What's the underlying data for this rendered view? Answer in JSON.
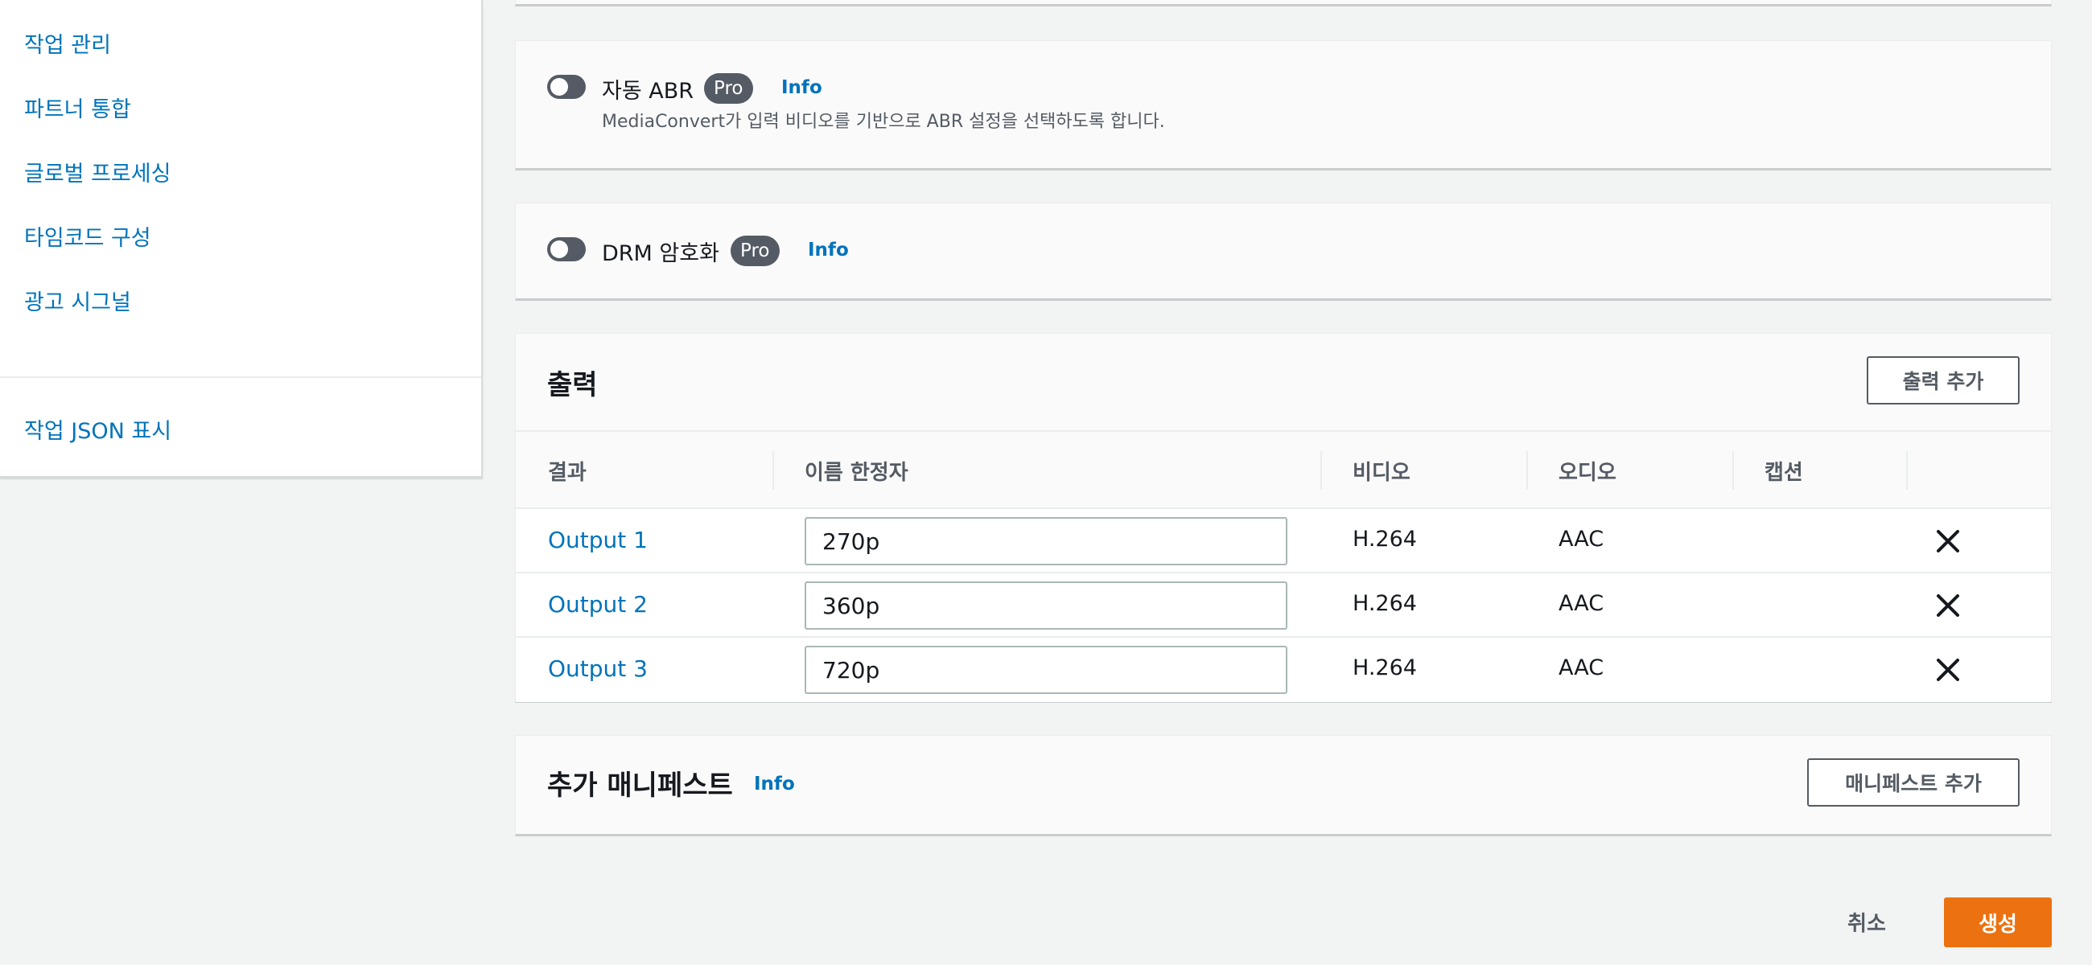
{
  "sidebar": {
    "items": [
      {
        "label": "작업 관리"
      },
      {
        "label": "파트너 통합"
      },
      {
        "label": "글로벌 프로세싱"
      },
      {
        "label": "타임코드 구성"
      },
      {
        "label": "광고 시그널"
      }
    ],
    "json_link": "작업 JSON 표시"
  },
  "auto_abr": {
    "label": "자동 ABR",
    "badge": "Pro",
    "info": "Info",
    "description": "MediaConvert가 입력 비디오를 기반으로 ABR 설정을 선택하도록 합니다.",
    "enabled": false
  },
  "drm": {
    "label": "DRM 암호화",
    "badge": "Pro",
    "info": "Info",
    "enabled": false
  },
  "outputs": {
    "title": "출력",
    "add_button": "출력 추가",
    "columns": [
      "결과",
      "이름 한정자",
      "비디오",
      "오디오",
      "캡션"
    ],
    "rows": [
      {
        "name": "Output 1",
        "modifier": "270p",
        "video": "H.264",
        "audio": "AAC",
        "caption": ""
      },
      {
        "name": "Output 2",
        "modifier": "360p",
        "video": "H.264",
        "audio": "AAC",
        "caption": ""
      },
      {
        "name": "Output 3",
        "modifier": "720p",
        "video": "H.264",
        "audio": "AAC",
        "caption": ""
      }
    ]
  },
  "manifests": {
    "title": "추가 매니페스트",
    "info": "Info",
    "add_button": "매니페스트 추가"
  },
  "footer": {
    "cancel": "취소",
    "create": "생성"
  },
  "colors": {
    "link": "#0073bb",
    "primary_button": "#ec7211",
    "badge": "#545b64"
  }
}
